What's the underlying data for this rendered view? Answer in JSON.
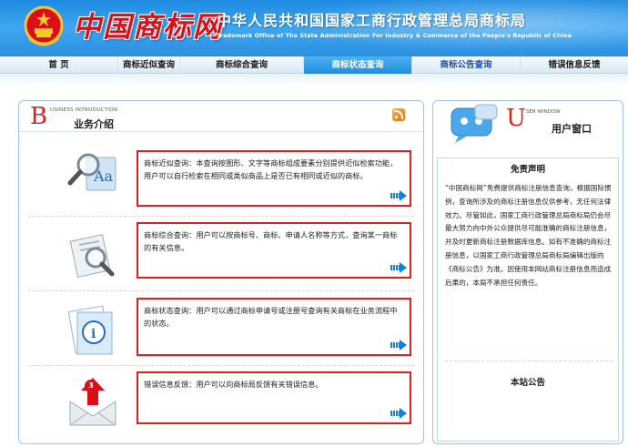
{
  "header": {
    "brand": "中国商标网",
    "office_cn": "中华人民共和国国家工商行政管理总局商标局",
    "office_en": "Trademark Office of The State Administration For Industry & Commerce of the People's Republic of China"
  },
  "nav": [
    {
      "label": "首 页"
    },
    {
      "label": "商标近似查询"
    },
    {
      "label": "商标综合查询"
    },
    {
      "label": "商标状态查询"
    },
    {
      "label": "商标公告查询"
    },
    {
      "label": "错误信息反馈"
    }
  ],
  "business": {
    "big_letter": "B",
    "small_en": "USINESS INTRODUCTION",
    "title": "业务介绍",
    "items": [
      {
        "text": "商标近似查询：本查询按图形、文字等商标组成要素分别提供近似检索功能，用户可以自行检索在相同或类似商品上是否已有相同或近似的商标。"
      },
      {
        "text": "商标综合查询：用户可以按商标号、商标、申请人名称等方式，查询某一商标的有关信息。"
      },
      {
        "text": "商标状态查询：用户可以通过商标申请号或注册号查询有关商标在业务流程中的状态。"
      },
      {
        "text": "错误信息反馈：用户可以向商标局反馈有关错误信息。"
      }
    ],
    "feedback_badge": "3"
  },
  "user_window": {
    "big_letter": "U",
    "small_en": "SER WINDOW",
    "title": "用户窗口",
    "disclaimer_title": "免责声明",
    "disclaimer_text": "“中国商标网”免费提供商标注册信息查询，根据国际惯例，查询所涉及的商标注册信息仅供参考，无任何法律效力。尽管如此，国家工商行政管理总局商标局仍会尽最大努力向中外公众提供尽可能准确的商标注册信息，并及时更新商标注册数据库信息。如有不准确的商标注册信息，以国家工商行政管理总局商标局编辑出版的《商标公告》为准。因使用本网站商标注册信息而造成后果的，本局不承担任何责任。",
    "notice_title": "本站公告"
  }
}
